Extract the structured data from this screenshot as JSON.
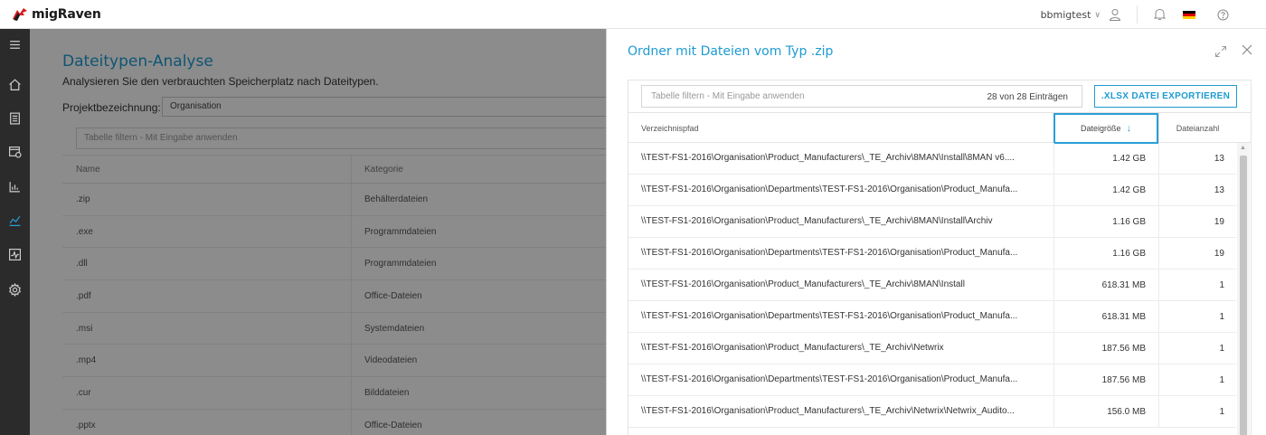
{
  "app": {
    "brand": "migRaven"
  },
  "topbar": {
    "user": "bbmigtest"
  },
  "main": {
    "title": "Dateitypen-Analyse",
    "subtitle": "Analysieren Sie den verbrauchten Speicherplatz nach Dateitypen.",
    "project_label": "Projektbezeichnung:",
    "project_value": "Organisation",
    "filter_placeholder": "Tabelle filtern - Mit Eingabe anwenden",
    "columns": [
      "Name",
      "Kategorie"
    ],
    "rows": [
      {
        "name": ".zip",
        "category": "Behälterdateien"
      },
      {
        "name": ".exe",
        "category": "Programmdateien"
      },
      {
        "name": ".dll",
        "category": "Programmdateien"
      },
      {
        "name": ".pdf",
        "category": "Office-Dateien"
      },
      {
        "name": ".msi",
        "category": "Systemdateien"
      },
      {
        "name": ".mp4",
        "category": "Videodateien"
      },
      {
        "name": ".cur",
        "category": "Bilddateien"
      },
      {
        "name": ".pptx",
        "category": "Office-Dateien"
      }
    ]
  },
  "panel": {
    "title": "Ordner mit Dateien vom Typ .zip",
    "filter_placeholder": "Tabelle filtern - Mit Eingabe anwenden",
    "count_text": "28 von 28 Einträgen",
    "export_label": ".XLSX DATEI EXPORTIEREN",
    "columns": {
      "path": "Verzeichnispfad",
      "size": "Dateigröße",
      "count": "Dateianzahl"
    },
    "rows": [
      {
        "path": "\\\\TEST-FS1-2016\\Organisation\\Product_Manufacturers\\_TE_Archiv\\8MAN\\Install\\8MAN v6....",
        "size": "1.42 GB",
        "count": "13"
      },
      {
        "path": "\\\\TEST-FS1-2016\\Organisation\\Departments\\TEST-FS1-2016\\Organisation\\Product_Manufa...",
        "size": "1.42 GB",
        "count": "13"
      },
      {
        "path": "\\\\TEST-FS1-2016\\Organisation\\Product_Manufacturers\\_TE_Archiv\\8MAN\\Install\\Archiv",
        "size": "1.16 GB",
        "count": "19"
      },
      {
        "path": "\\\\TEST-FS1-2016\\Organisation\\Departments\\TEST-FS1-2016\\Organisation\\Product_Manufa...",
        "size": "1.16 GB",
        "count": "19"
      },
      {
        "path": "\\\\TEST-FS1-2016\\Organisation\\Product_Manufacturers\\_TE_Archiv\\8MAN\\Install",
        "size": "618.31 MB",
        "count": "1"
      },
      {
        "path": "\\\\TEST-FS1-2016\\Organisation\\Departments\\TEST-FS1-2016\\Organisation\\Product_Manufa...",
        "size": "618.31 MB",
        "count": "1"
      },
      {
        "path": "\\\\TEST-FS1-2016\\Organisation\\Product_Manufacturers\\_TE_Archiv\\Netwrix",
        "size": "187.56 MB",
        "count": "1"
      },
      {
        "path": "\\\\TEST-FS1-2016\\Organisation\\Departments\\TEST-FS1-2016\\Organisation\\Product_Manufa...",
        "size": "187.56 MB",
        "count": "1"
      },
      {
        "path": "\\\\TEST-FS1-2016\\Organisation\\Product_Manufacturers\\_TE_Archiv\\Netwrix\\Netwrix_Audito...",
        "size": "156.0 MB",
        "count": "1"
      }
    ]
  },
  "icons": {
    "sidebar": [
      "menu-icon",
      "home-icon",
      "clipboard-icon",
      "calendar-clock-icon",
      "bar-chart-icon",
      "line-chart-icon",
      "activity-chart-icon",
      "settings-icon"
    ],
    "topbar": [
      "user-icon",
      "bell-icon",
      "flag-de-icon",
      "help-icon"
    ]
  },
  "colors": {
    "accent": "#1d9bd1",
    "sidebar": "#2b2b2b",
    "flag": [
      "#000000",
      "#dd0000",
      "#ffce00"
    ]
  }
}
